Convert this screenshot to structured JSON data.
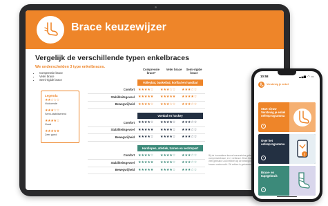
{
  "tablet": {
    "title": "Brace keuzewijzer",
    "heading": "Vergelijk de verschillende typen enkelbraces",
    "subheading": "We onderscheiden 3 type enkelbraces.",
    "types": [
      "Compressie brace",
      "Veter brace",
      "Semi-rigide brace"
    ],
    "columns": [
      "Compressie brace*",
      "Veter brace",
      "Semi-rigide brace"
    ],
    "legend": {
      "title": "Legenda",
      "items": [
        {
          "stars": "★★☆☆☆",
          "label": "Voldoende"
        },
        {
          "stars": "★★★☆☆",
          "label": "Semi-stabiliserend"
        },
        {
          "stars": "★★★★☆",
          "label": "Goed"
        },
        {
          "stars": "★★★★★",
          "label": "Zeer goed"
        }
      ]
    },
    "sections": [
      {
        "title": "Volleybal, basketbal, korfbal en handbal",
        "color": "#ee8529",
        "rows": [
          {
            "label": "Comfort",
            "ratings": [
              "★★★★☆",
              "★★★☆☆",
              "★★★☆☆"
            ]
          },
          {
            "label": "Stabiliteitsgevoel",
            "ratings": [
              "★★★★★",
              "★★★★★",
              "★★★★☆"
            ]
          },
          {
            "label": "Bewegvrijheid",
            "ratings": [
              "★★★★☆",
              "★★★☆☆",
              "★★★☆☆"
            ]
          }
        ]
      },
      {
        "title": "Voetbal en hockey",
        "color": "#233042",
        "rows": [
          {
            "label": "Comfort",
            "ratings": [
              "★★★★☆",
              "★★★★☆",
              "★★★☆☆"
            ]
          },
          {
            "label": "Stabiliteitsgevoel",
            "ratings": [
              "★★★★★",
              "★★★★☆",
              "★★★☆☆"
            ]
          },
          {
            "label": "Bewegvrijheid",
            "ratings": [
              "★★★★☆",
              "★★★★☆",
              "★★★☆☆"
            ]
          }
        ]
      },
      {
        "title": "Hardlopen, atletiek, turnen en vechtsport",
        "color": "#3c8a7a",
        "rows": [
          {
            "label": "Comfort",
            "ratings": [
              "★★★★☆",
              "★★★★☆",
              "★★★☆☆"
            ]
          },
          {
            "label": "Stabiliteitsgevoel",
            "ratings": [
              "★★★★★",
              "★★★★☆",
              "★★★☆☆"
            ]
          },
          {
            "label": "Bewegvrijheid",
            "ratings": [
              "★★★★★",
              "★★★★☆",
              "★★★☆☆"
            ]
          }
        ]
      }
    ],
    "footnote": "Bij de innovatieve keuze braceadvies gebruiken wij 1 compressiebrace, en 1 vetbrace. Deze braces zijn bekend en veel gebruikt. Ook hebben wij de bewegingsvrijheid van deze braces onderzocht. Dit advies is gebaseerd op onderzoek."
  },
  "phone": {
    "time": "10:58",
    "status": "▂▄▆ ◠ ▭",
    "app_title": "Verstevig je enkel",
    "cards": [
      {
        "label": "Start nieuw Verstevig je enkel oefenprogramma",
        "bg": "#ee8529",
        "img_bg": "#f5b072",
        "icon": "ankle-icon"
      },
      {
        "label": "Over het oefenprogramma",
        "bg": "#233042",
        "img_bg": "#e6eef3",
        "icon": "phone-info-icon"
      },
      {
        "label": "Brace- en tapegebruik",
        "bg": "#3c8a7a",
        "img_bg": "#d9d6ec",
        "icon": "brace-icon"
      }
    ]
  }
}
